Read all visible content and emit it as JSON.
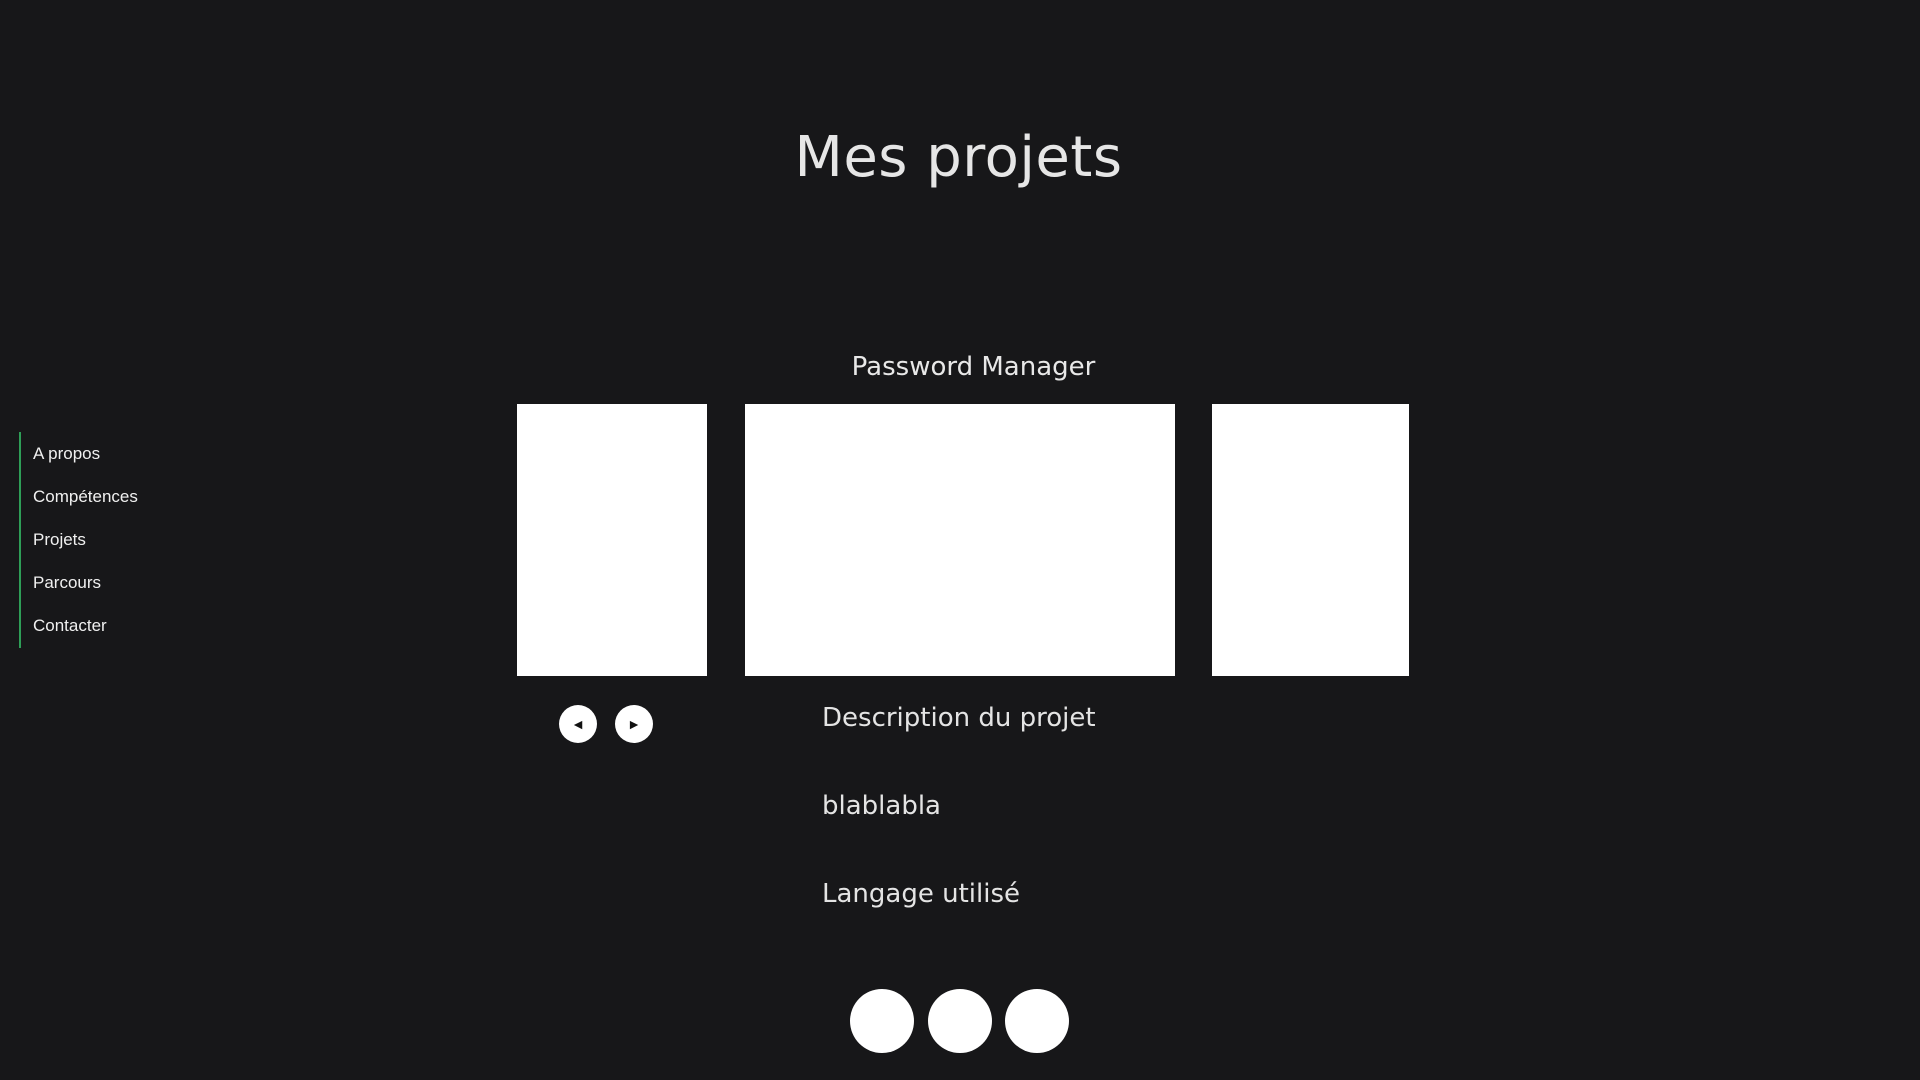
{
  "header": {
    "title": "Mes projets"
  },
  "sidebar": {
    "items": [
      {
        "label": "A propos"
      },
      {
        "label": "Compétences"
      },
      {
        "label": "Projets"
      },
      {
        "label": "Parcours"
      },
      {
        "label": "Contacter"
      }
    ],
    "accent_color": "#2e9e57"
  },
  "project": {
    "name": "Password Manager",
    "description_heading": "Description du projet",
    "description_text": "blablabla",
    "language_heading": "Langage utilisé"
  },
  "carousel": {
    "prev_icon": "triangle-left-icon",
    "next_icon": "triangle-right-icon",
    "prev_glyph": "◄",
    "next_glyph": "►"
  },
  "languages": {
    "icon_count": 3
  },
  "colors": {
    "background": "#171719",
    "text": "#e2e2e2",
    "placeholder": "#ffffff"
  }
}
